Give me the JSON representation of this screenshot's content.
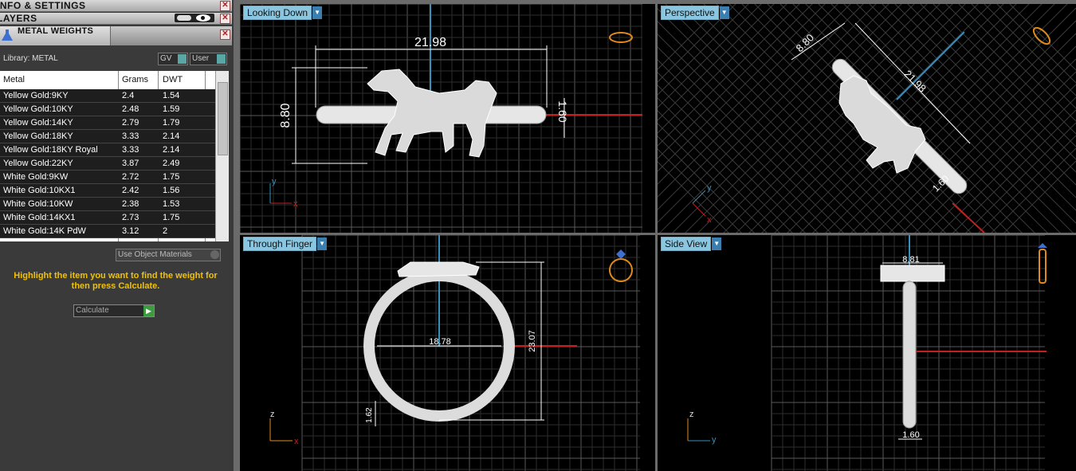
{
  "panels": {
    "info_settings": "INFO & SETTINGS",
    "layers": "LAYERS",
    "metal_weights": "METAL WEIGHTS"
  },
  "library": "Library: METAL",
  "toggles": {
    "gv": "GV",
    "user": "User"
  },
  "table": {
    "headers": [
      "Metal",
      "Grams",
      "DWT"
    ],
    "rows": [
      {
        "metal": "Yellow Gold:9KY",
        "grams": "2.4",
        "dwt": "1.54"
      },
      {
        "metal": "Yellow Gold:10KY",
        "grams": "2.48",
        "dwt": "1.59"
      },
      {
        "metal": "Yellow Gold:14KY",
        "grams": "2.79",
        "dwt": "1.79"
      },
      {
        "metal": "Yellow Gold:18KY",
        "grams": "3.33",
        "dwt": "2.14"
      },
      {
        "metal": "Yellow Gold:18KY Royal",
        "grams": "3.33",
        "dwt": "2.14"
      },
      {
        "metal": "Yellow Gold:22KY",
        "grams": "3.87",
        "dwt": "2.49"
      },
      {
        "metal": "White Gold:9KW",
        "grams": "2.72",
        "dwt": "1.75"
      },
      {
        "metal": "White Gold:10KX1",
        "grams": "2.42",
        "dwt": "1.56"
      },
      {
        "metal": "White Gold:10KW",
        "grams": "2.38",
        "dwt": "1.53"
      },
      {
        "metal": "White Gold:14KX1",
        "grams": "2.73",
        "dwt": "1.75"
      },
      {
        "metal": "White Gold:14K PdW",
        "grams": "3.12",
        "dwt": "2"
      }
    ]
  },
  "use_object_materials": "Use Object Materials",
  "hint": "Highlight the item you want to find the weight for then press Calculate.",
  "calculate": "Calculate",
  "viewports": {
    "looking_down": {
      "label": "Looking Down",
      "dims": [
        "21.98",
        "8.80",
        "1.60"
      ],
      "axes": [
        "y",
        "x"
      ]
    },
    "perspective": {
      "label": "Perspective",
      "dims": [
        "8.80",
        "21.98",
        "1.60"
      ],
      "axes": [
        "y",
        "x"
      ]
    },
    "through_finger": {
      "label": "Through Finger",
      "dims": [
        "18.78",
        "23.07",
        "1.62"
      ],
      "axes": [
        "z",
        "x"
      ]
    },
    "side_view": {
      "label": "Side View",
      "dims": [
        "8.81",
        "1.60"
      ],
      "axes": [
        "z",
        "y"
      ]
    }
  },
  "colors": {
    "accent": "#8ac6e0",
    "grid": "#3c3c3c",
    "axis_red": "#c02020",
    "axis_blue": "#3a8fb8",
    "hint": "#f2c200"
  }
}
